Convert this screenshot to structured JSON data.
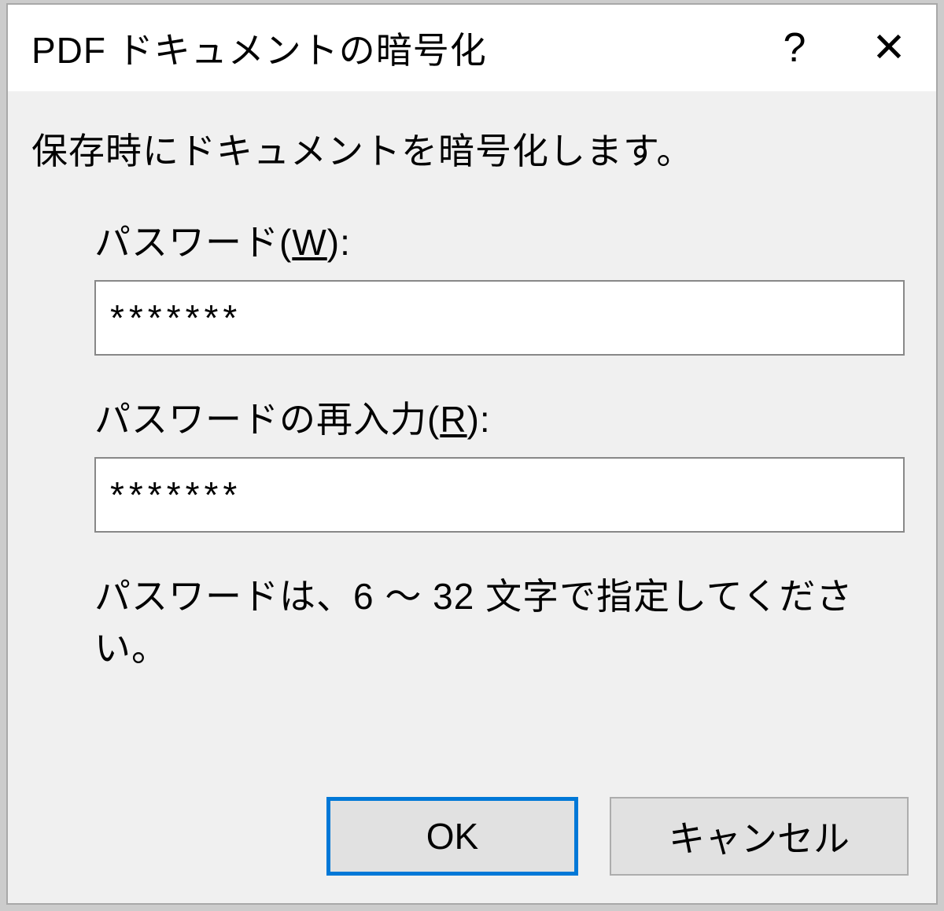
{
  "titlebar": {
    "title": "PDF ドキュメントの暗号化",
    "help_symbol": "?",
    "close_symbol": "✕"
  },
  "body": {
    "description": "保存時にドキュメントを暗号化します。",
    "password": {
      "label_prefix": "パスワード(",
      "label_accel": "W",
      "label_suffix": "):",
      "value": "*******"
    },
    "password_confirm": {
      "label_prefix": "パスワードの再入力(",
      "label_accel": "R",
      "label_suffix": "):",
      "value": "*******"
    },
    "hint": "パスワードは、6 ～ 32 文字で指定してください。"
  },
  "buttons": {
    "ok": "OK",
    "cancel": "キャンセル"
  }
}
